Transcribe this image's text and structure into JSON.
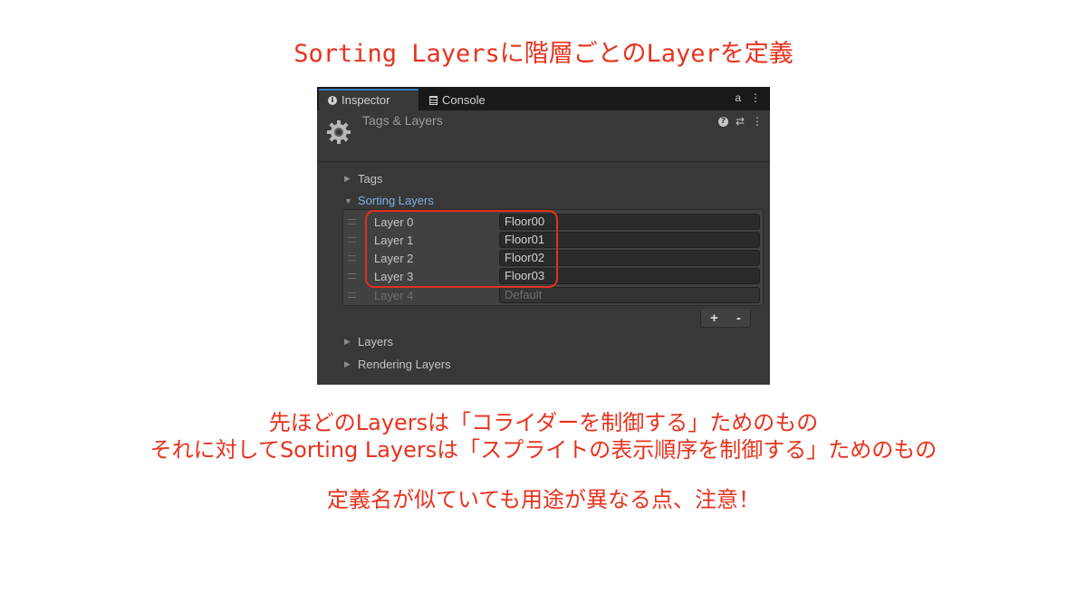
{
  "annotations": {
    "title": "Sorting Layersに階層ごとのLayerを定義",
    "note_line1": "先ほどのLayersは「コライダーを制御する」ためのもの",
    "note_line2": "それに対してSorting Layersは「スプライトの表示順序を制御する」ためのもの",
    "note_line3": "定義名が似ていても用途が異なる点、注意！"
  },
  "colors": {
    "annotation_red": "#e8321e",
    "panel_bg": "#383838",
    "tabbar_bg": "#191919",
    "foldout_active_blue": "#7ab1e8"
  },
  "inspector": {
    "tabs": [
      {
        "label": "Inspector",
        "icon": "info-icon"
      },
      {
        "label": "Console",
        "icon": "console-icon"
      }
    ],
    "tabbar_icons": {
      "lock": "a",
      "menu": "⋮"
    },
    "header": {
      "title": "Tags & Layers",
      "icon": "gear-icon",
      "help_icon": "?",
      "settings_icon": "⇄",
      "menu_icon": "⋮"
    },
    "foldouts": {
      "tags": "Tags",
      "sorting_layers": "Sorting Layers",
      "layers": "Layers",
      "rendering_layers": "Rendering Layers"
    },
    "sorting_layers": [
      {
        "label": "Layer 0",
        "value": "Floor00"
      },
      {
        "label": "Layer 1",
        "value": "Floor01"
      },
      {
        "label": "Layer 2",
        "value": "Floor02"
      },
      {
        "label": "Layer 3",
        "value": "Floor03"
      },
      {
        "label": "Layer 4",
        "value": "Default"
      }
    ],
    "list_buttons": {
      "add": "+",
      "remove": "-"
    }
  }
}
